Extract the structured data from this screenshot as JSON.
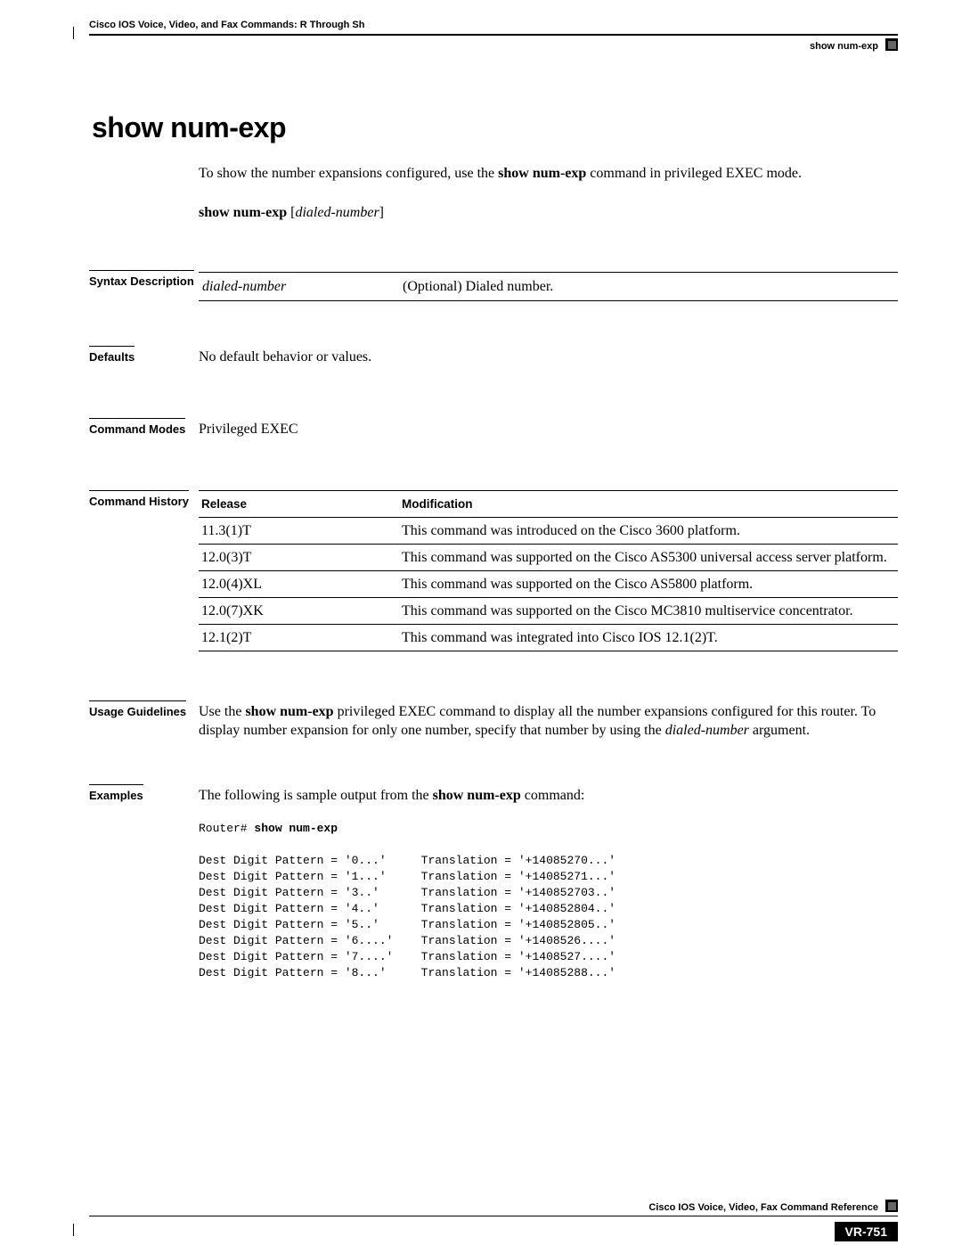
{
  "header": {
    "chapter": "Cisco IOS Voice, Video, and Fax Commands: R Through Sh",
    "command": "show num-exp"
  },
  "title": "show num-exp",
  "intro": {
    "pre": "To show the number expansions configured, use the ",
    "cmd": "show num-exp",
    "post": " command in privileged EXEC mode."
  },
  "syntax": {
    "cmd": "show num-exp",
    "arg": "dialed-number"
  },
  "sections": {
    "syntax_desc_label": "Syntax Description",
    "syntax_desc": {
      "param": "dialed-number",
      "desc": "(Optional) Dialed number."
    },
    "defaults_label": "Defaults",
    "defaults": "No default behavior or values.",
    "modes_label": "Command Modes",
    "modes": "Privileged EXEC",
    "history_label": "Command History",
    "history_headers": {
      "release": "Release",
      "modification": "Modification"
    },
    "history": [
      {
        "release": "11.3(1)T",
        "mod": "This command was introduced on the Cisco 3600 platform."
      },
      {
        "release": "12.0(3)T",
        "mod": "This command was supported on the Cisco AS5300 universal access server platform."
      },
      {
        "release": "12.0(4)XL",
        "mod": "This command was supported on the Cisco AS5800 platform."
      },
      {
        "release": "12.0(7)XK",
        "mod": "This command was supported on the Cisco MC3810 multiservice concentrator."
      },
      {
        "release": "12.1(2)T",
        "mod": "This command was integrated into Cisco IOS 12.1(2)T."
      }
    ],
    "usage_label": "Usage Guidelines",
    "usage": {
      "p1a": "Use the ",
      "p1cmd": "show num-exp",
      "p1b": " privileged EXEC command to display all the number expansions configured for this router. To display number expansion for only one number, specify that number by using the ",
      "p1arg": "dialed-number",
      "p1c": " argument."
    },
    "examples_label": "Examples",
    "examples_intro": {
      "a": "The following is sample output from the ",
      "cmd": "show num-exp",
      "b": " command:"
    },
    "code_prompt": "Router# ",
    "code_cmd": "show num-exp",
    "code_lines": [
      "Dest Digit Pattern = '0...'     Translation = '+14085270...'",
      "Dest Digit Pattern = '1...'     Translation = '+14085271...'",
      "Dest Digit Pattern = '3..'      Translation = '+140852703..'",
      "Dest Digit Pattern = '4..'      Translation = '+140852804..'",
      "Dest Digit Pattern = '5..'      Translation = '+140852805..'",
      "Dest Digit Pattern = '6....'    Translation = '+1408526....'",
      "Dest Digit Pattern = '7....'    Translation = '+1408527....'",
      "Dest Digit Pattern = '8...'     Translation = '+14085288...'"
    ]
  },
  "footer": {
    "book": "Cisco IOS Voice, Video, Fax Command Reference",
    "pagenum": "VR-751"
  }
}
